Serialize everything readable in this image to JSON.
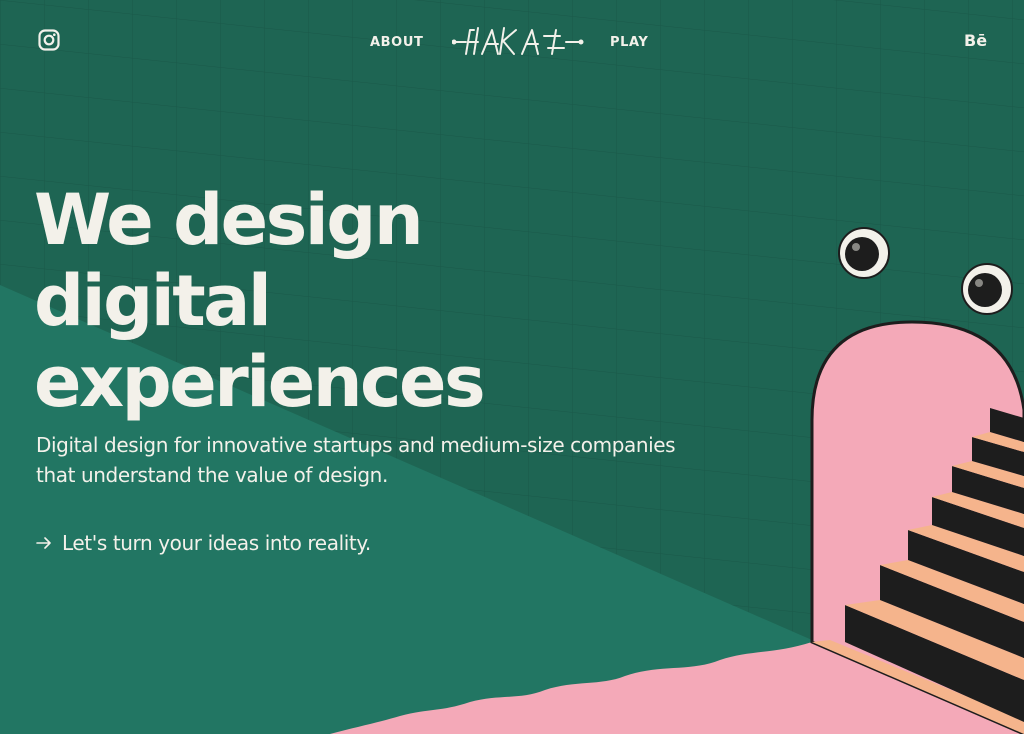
{
  "nav": {
    "instagram_icon": "instagram-icon",
    "about_label": "ABOUT",
    "logo_text": "HAKA",
    "play_label": "PLAY",
    "behance_label": "Bē"
  },
  "hero": {
    "headline_lines": [
      "We design",
      "digital",
      "experiences"
    ],
    "subtext": "Digital design for innovative startups and medium-size companies that understand the value of design.",
    "cta_icon": "arrow-right-icon",
    "cta_label": "Let's turn your ideas into reality."
  },
  "colors": {
    "background_green": "#1e6553",
    "text_cream": "#f3f1ea",
    "arch_pink": "#f4a9b8",
    "step_peach": "#f5b48c",
    "step_dark": "#1d1d1d"
  }
}
